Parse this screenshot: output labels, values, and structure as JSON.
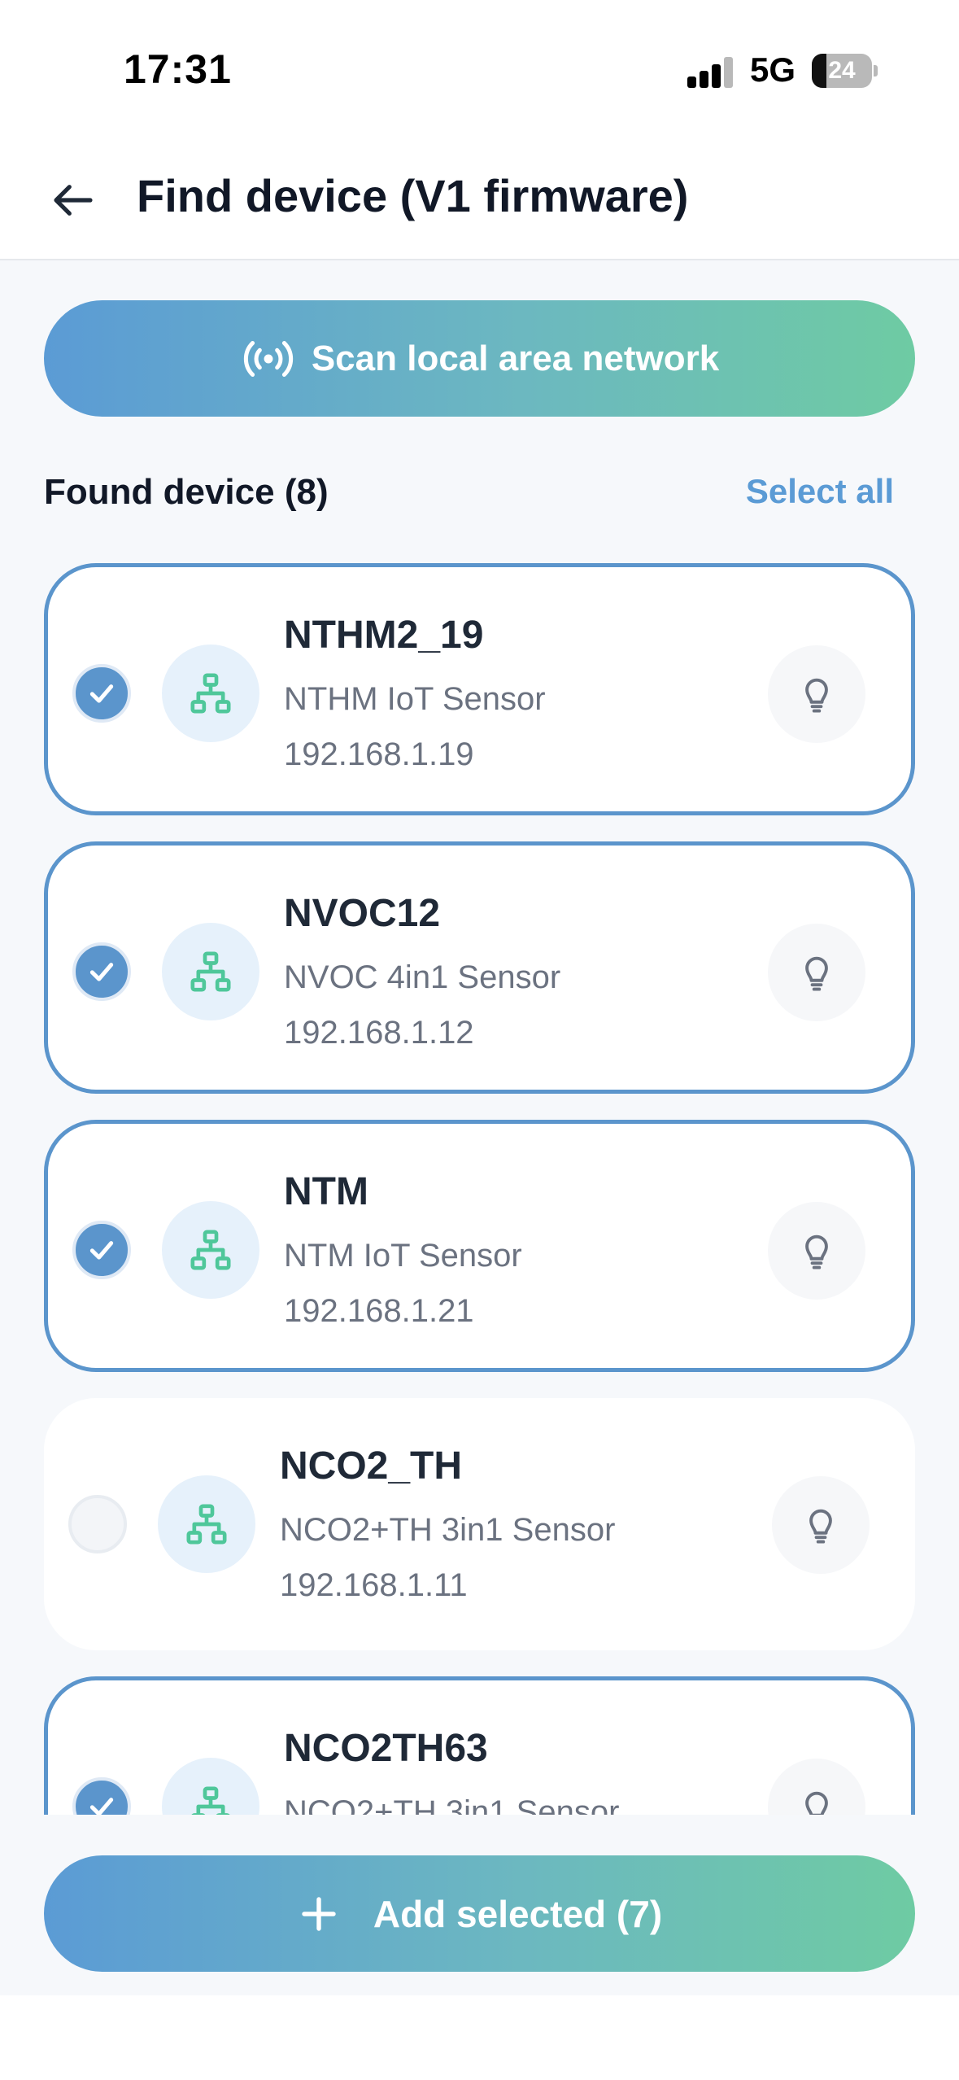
{
  "status_bar": {
    "time": "17:31",
    "network": "5G",
    "battery": "24",
    "battery_percent": 24
  },
  "header": {
    "title": "Find device (V1 firmware)",
    "back_icon": "arrow-left-icon"
  },
  "scan": {
    "label": "Scan local area network",
    "icon": "broadcast-icon"
  },
  "devices_section": {
    "title": "Found device (8)",
    "select_all": "Select all"
  },
  "devices": [
    {
      "name": "NTHM2_19",
      "model": "NTHM IoT Sensor",
      "ip": "192.168.1.19",
      "selected": true
    },
    {
      "name": "NVOC12",
      "model": "NVOC 4in1 Sensor",
      "ip": "192.168.1.12",
      "selected": true
    },
    {
      "name": "NTM",
      "model": "NTM IoT Sensor",
      "ip": "192.168.1.21",
      "selected": true
    },
    {
      "name": "NCO2_TH",
      "model": "NCO2+TH 3in1 Sensor",
      "ip": "192.168.1.11",
      "selected": false
    },
    {
      "name": "NCO2TH63",
      "model": "NCO2+TH 3in1 Sensor",
      "ip": "",
      "selected": true
    }
  ],
  "footer": {
    "add_label": "Add selected (7)",
    "add_icon": "plus-icon"
  },
  "colors": {
    "accent": "#5b95cc",
    "gradient_start": "#5b9bd5",
    "gradient_end": "#6ecba3",
    "device_icon": "#4fc79a"
  }
}
